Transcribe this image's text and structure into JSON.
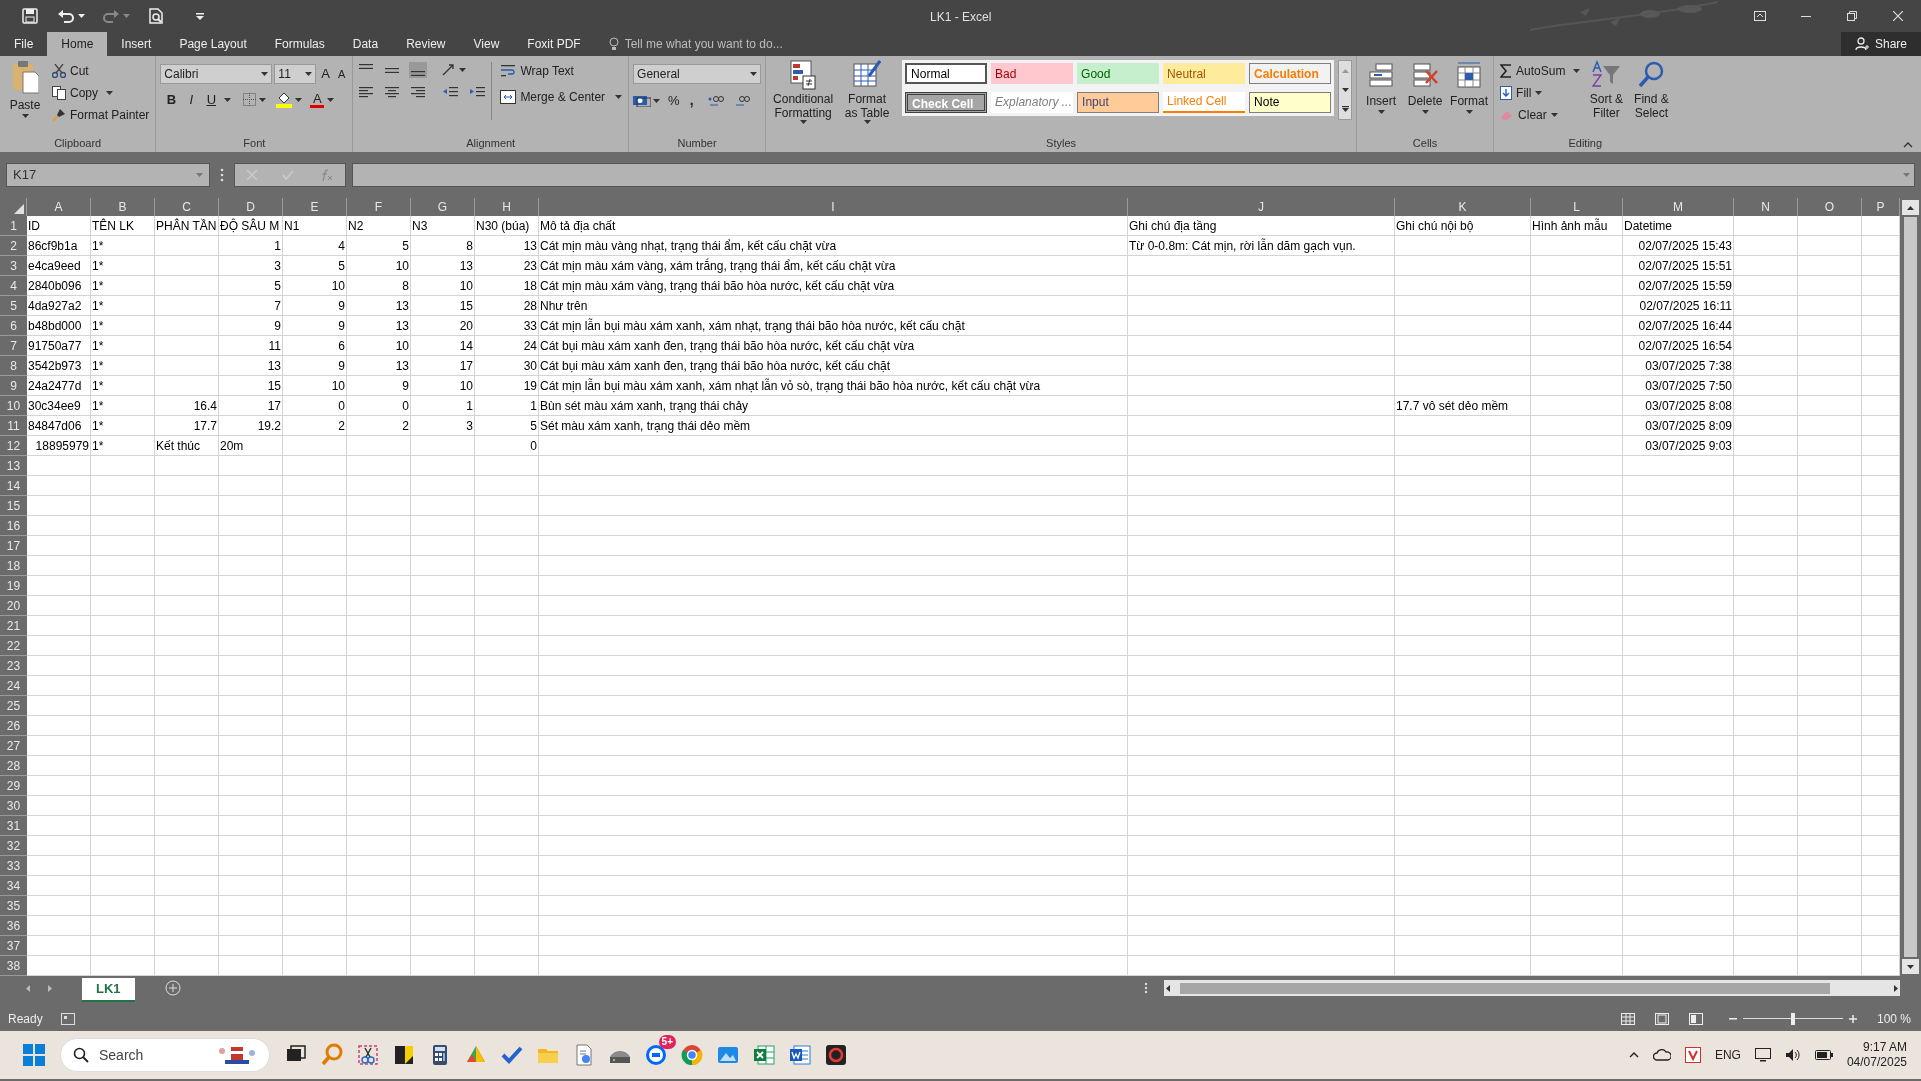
{
  "title_bar": {
    "title": "LK1 - Excel"
  },
  "menu_tabs": [
    {
      "label": "File",
      "selected": false
    },
    {
      "label": "Home",
      "selected": true
    },
    {
      "label": "Insert",
      "selected": false
    },
    {
      "label": "Page Layout",
      "selected": false
    },
    {
      "label": "Formulas",
      "selected": false
    },
    {
      "label": "Data",
      "selected": false
    },
    {
      "label": "Review",
      "selected": false
    },
    {
      "label": "View",
      "selected": false
    },
    {
      "label": "Foxit PDF",
      "selected": false
    }
  ],
  "tell_me": {
    "placeholder": "Tell me what you want to do..."
  },
  "share": "Share",
  "ribbon": {
    "clipboard": {
      "label": "Clipboard",
      "paste": "Paste",
      "cut": "Cut",
      "copy": "Copy",
      "format_painter": "Format Painter"
    },
    "font": {
      "label": "Font",
      "font_name": "Calibri",
      "font_size": "11",
      "grow": "A",
      "shrink": "A",
      "bold": "B",
      "italic": "I",
      "underline": "U",
      "font_color": "A"
    },
    "alignment": {
      "label": "Alignment",
      "wrap_text": "Wrap Text",
      "merge_center": "Merge & Center"
    },
    "number": {
      "label": "Number",
      "format": "General",
      "percent": "%",
      "comma": ","
    },
    "styles": {
      "label": "Styles",
      "conditional_formatting": "Conditional Formatting",
      "format_as_table": "Format as Table",
      "cell_styles": [
        {
          "label": "Normal",
          "kind": "normal",
          "color": "#ffffff"
        },
        {
          "label": "Bad",
          "kind": "bad",
          "color": "#ffc7ce"
        },
        {
          "label": "Good",
          "kind": "good",
          "color": "#c6efce"
        },
        {
          "label": "Neutral",
          "kind": "neutral",
          "color": "#ffeb9c"
        },
        {
          "label": "Calculation",
          "kind": "calculation",
          "color": "#f2f2f2"
        },
        {
          "label": "Check Cell",
          "kind": "check",
          "color": "#a5a5a5"
        },
        {
          "label": "Explanatory ...",
          "kind": "explanatory",
          "color": "#ffffff"
        },
        {
          "label": "Input",
          "kind": "input",
          "color": "#ffcc99"
        },
        {
          "label": "Linked Cell",
          "kind": "linked",
          "color": "#ffffff"
        },
        {
          "label": "Note",
          "kind": "note",
          "color": "#ffffcc"
        }
      ]
    },
    "cells": {
      "label": "Cells",
      "buttons": [
        "Insert",
        "Delete",
        "Format"
      ]
    },
    "editing": {
      "label": "Editing",
      "autosum": "AutoSum",
      "fill": "Fill",
      "clear": "Clear",
      "sort_filter": "Sort & Filter",
      "find_select": "Find & Select"
    }
  },
  "formula_bar": {
    "name_box": "K17"
  },
  "sheet": {
    "columns": [
      "A",
      "B",
      "C",
      "D",
      "E",
      "F",
      "G",
      "H",
      "I",
      "J",
      "K",
      "L",
      "M",
      "N",
      "O",
      "P"
    ],
    "rows": [
      {
        "number": "1",
        "cells": [
          "ID",
          "TÊN LK",
          "PHÂN TẦN",
          "ĐỘ SÂU M",
          "N1",
          "N2",
          "N3",
          "N30 (búa)",
          "Mô tả địa chất",
          "Ghi chú địa tầng",
          "Ghi chú nội bộ",
          "Hình ảnh mẫu",
          "Datetime"
        ]
      },
      {
        "number": "2",
        "cells": [
          "86cf9b1a",
          "1*",
          null,
          {
            "text": "1",
            "kind": "number"
          },
          {
            "text": "4",
            "kind": "number"
          },
          {
            "text": "5",
            "kind": "number"
          },
          {
            "text": "8",
            "kind": "number"
          },
          {
            "text": "13",
            "kind": "number"
          },
          "Cát mịn màu vàng nhạt, trạng thái ẩm, kết cấu chặt vừa",
          "Từ 0-0.8m: Cát mịn, rời lẫn dăm gạch vụn.",
          null,
          null,
          {
            "text": "02/07/2025 15:43",
            "kind": "number"
          }
        ]
      },
      {
        "number": "3",
        "cells": [
          "e4ca9eed",
          "1*",
          null,
          {
            "text": "3",
            "kind": "number"
          },
          {
            "text": "5",
            "kind": "number"
          },
          {
            "text": "10",
            "kind": "number"
          },
          {
            "text": "13",
            "kind": "number"
          },
          {
            "text": "23",
            "kind": "number"
          },
          "Cát mịn màu xám vàng, xám trắng, trạng thái ẩm, kết cấu chặt vừa",
          null,
          null,
          null,
          {
            "text": "02/07/2025 15:51",
            "kind": "number"
          }
        ]
      },
      {
        "number": "4",
        "cells": [
          "2840b096",
          "1*",
          null,
          {
            "text": "5",
            "kind": "number"
          },
          {
            "text": "10",
            "kind": "number"
          },
          {
            "text": "8",
            "kind": "number"
          },
          {
            "text": "10",
            "kind": "number"
          },
          {
            "text": "18",
            "kind": "number"
          },
          "Cát mịn màu xám vàng, trạng thái bão hòa nước, kết cấu chặt vừa",
          null,
          null,
          null,
          {
            "text": "02/07/2025 15:59",
            "kind": "number"
          }
        ]
      },
      {
        "number": "5",
        "cells": [
          "4da927a2",
          "1*",
          null,
          {
            "text": "7",
            "kind": "number"
          },
          {
            "text": "9",
            "kind": "number"
          },
          {
            "text": "13",
            "kind": "number"
          },
          {
            "text": "15",
            "kind": "number"
          },
          {
            "text": "28",
            "kind": "number"
          },
          "Như trên",
          null,
          null,
          null,
          {
            "text": "02/07/2025 16:11",
            "kind": "number"
          }
        ]
      },
      {
        "number": "6",
        "cells": [
          "b48bd000",
          "1*",
          null,
          {
            "text": "9",
            "kind": "number"
          },
          {
            "text": "9",
            "kind": "number"
          },
          {
            "text": "13",
            "kind": "number"
          },
          {
            "text": "20",
            "kind": "number"
          },
          {
            "text": "33",
            "kind": "number"
          },
          "Cát mịn lẫn bụi màu xám xanh, xám nhạt, trạng thái bão hòa nước, kết cấu chặt",
          null,
          null,
          null,
          {
            "text": "02/07/2025 16:44",
            "kind": "number"
          }
        ]
      },
      {
        "number": "7",
        "cells": [
          "91750a77",
          "1*",
          null,
          {
            "text": "11",
            "kind": "number"
          },
          {
            "text": "6",
            "kind": "number"
          },
          {
            "text": "10",
            "kind": "number"
          },
          {
            "text": "14",
            "kind": "number"
          },
          {
            "text": "24",
            "kind": "number"
          },
          "Cát bụi màu xám xanh đen, trạng thái bão hòa nước, kết cấu chặt vừa",
          null,
          null,
          null,
          {
            "text": "02/07/2025 16:54",
            "kind": "number"
          }
        ]
      },
      {
        "number": "8",
        "cells": [
          "3542b973",
          "1*",
          null,
          {
            "text": "13",
            "kind": "number"
          },
          {
            "text": "9",
            "kind": "number"
          },
          {
            "text": "13",
            "kind": "number"
          },
          {
            "text": "17",
            "kind": "number"
          },
          {
            "text": "30",
            "kind": "number"
          },
          "Cát bụi màu xám xanh đen, trạng thái bão hòa nước, kết cấu chặt",
          null,
          null,
          null,
          {
            "text": "03/07/2025 7:38",
            "kind": "number"
          }
        ]
      },
      {
        "number": "9",
        "cells": [
          "24a2477d",
          "1*",
          null,
          {
            "text": "15",
            "kind": "number"
          },
          {
            "text": "10",
            "kind": "number"
          },
          {
            "text": "9",
            "kind": "number"
          },
          {
            "text": "10",
            "kind": "number"
          },
          {
            "text": "19",
            "kind": "number"
          },
          "Cát mịn lẫn bụi màu xám xanh, xám nhạt lẫn vỏ sò, trạng thái bão hòa nước, kết cấu chặt vừa",
          null,
          null,
          null,
          {
            "text": "03/07/2025 7:50",
            "kind": "number"
          }
        ]
      },
      {
        "number": "10",
        "cells": [
          "30c34ee9",
          "1*",
          {
            "text": "16.4",
            "kind": "number"
          },
          {
            "text": "17",
            "kind": "number"
          },
          {
            "text": "0",
            "kind": "number"
          },
          {
            "text": "0",
            "kind": "number"
          },
          {
            "text": "1",
            "kind": "number"
          },
          {
            "text": "1",
            "kind": "number"
          },
          "Bùn sét màu xám xanh, trạng thái chảy",
          null,
          "17.7 vô sét dẻo mềm",
          null,
          {
            "text": "03/07/2025 8:08",
            "kind": "number"
          }
        ]
      },
      {
        "number": "11",
        "cells": [
          "84847d06",
          "1*",
          {
            "text": "17.7",
            "kind": "number"
          },
          {
            "text": "19.2",
            "kind": "number"
          },
          {
            "text": "2",
            "kind": "number"
          },
          {
            "text": "2",
            "kind": "number"
          },
          {
            "text": "3",
            "kind": "number"
          },
          {
            "text": "5",
            "kind": "number"
          },
          "Sét màu xám xanh, trạng thái dẻo mềm",
          null,
          null,
          null,
          {
            "text": "03/07/2025 8:09",
            "kind": "number"
          }
        ]
      },
      {
        "number": "12",
        "cells": [
          {
            "text": "18895979",
            "kind": "number"
          },
          "1*",
          "Kết thúc",
          "20m",
          null,
          null,
          null,
          {
            "text": "0",
            "kind": "number"
          },
          null,
          null,
          null,
          null,
          {
            "text": "03/07/2025 9:03",
            "kind": "number"
          }
        ]
      },
      {
        "number": "13"
      },
      {
        "number": "14"
      },
      {
        "number": "15"
      },
      {
        "number": "16"
      },
      {
        "number": "17"
      },
      {
        "number": "18"
      },
      {
        "number": "19"
      },
      {
        "number": "20"
      },
      {
        "number": "21"
      },
      {
        "number": "22"
      },
      {
        "number": "23"
      },
      {
        "number": "24"
      },
      {
        "number": "25"
      },
      {
        "number": "26"
      },
      {
        "number": "27"
      },
      {
        "number": "28"
      },
      {
        "number": "29"
      },
      {
        "number": "30"
      },
      {
        "number": "31"
      },
      {
        "number": "32"
      },
      {
        "number": "33"
      },
      {
        "number": "34"
      },
      {
        "number": "35"
      },
      {
        "number": "36"
      },
      {
        "number": "37"
      },
      {
        "number": "38"
      }
    ]
  },
  "sheet_tabs": [
    {
      "label": "LK1",
      "selected": true
    }
  ],
  "status_bar": {
    "status": "Ready",
    "zoom_slider": {
      "level": 0.5
    },
    "zoom": "100 %"
  },
  "taskbar": {
    "search_placeholder": "Search",
    "notification_badge": "5+",
    "language": "ENG",
    "time": "9:17 AM",
    "date": "04/07/2025"
  }
}
